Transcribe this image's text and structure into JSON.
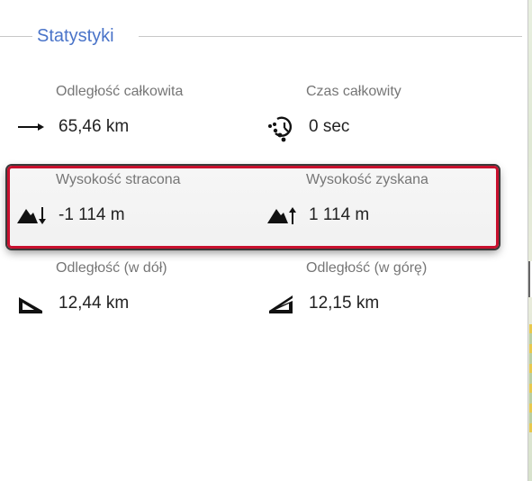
{
  "section": {
    "title": "Statystyki"
  },
  "stats": {
    "total_distance": {
      "label": "Odległość całkowita",
      "value": "65,46 km",
      "icon": "arrow-right-icon"
    },
    "total_time": {
      "label": "Czas całkowity",
      "value": "0 sec",
      "icon": "timer-icon"
    },
    "elevation_lost": {
      "label": "Wysokość stracona",
      "value": "-1 114 m",
      "icon": "mountain-down-icon"
    },
    "elevation_gained": {
      "label": "Wysokość zyskana",
      "value": "1 114 m",
      "icon": "mountain-up-icon"
    },
    "distance_down": {
      "label": "Odległość (w dół)",
      "value": "12,44 km",
      "icon": "slope-down-icon"
    },
    "distance_up": {
      "label": "Odległość (w górę)",
      "value": "12,15 km",
      "icon": "slope-up-icon"
    }
  },
  "colors": {
    "title": "#4a74c9",
    "highlight_border": "#c8102e",
    "label": "#767676",
    "value": "#222222"
  }
}
